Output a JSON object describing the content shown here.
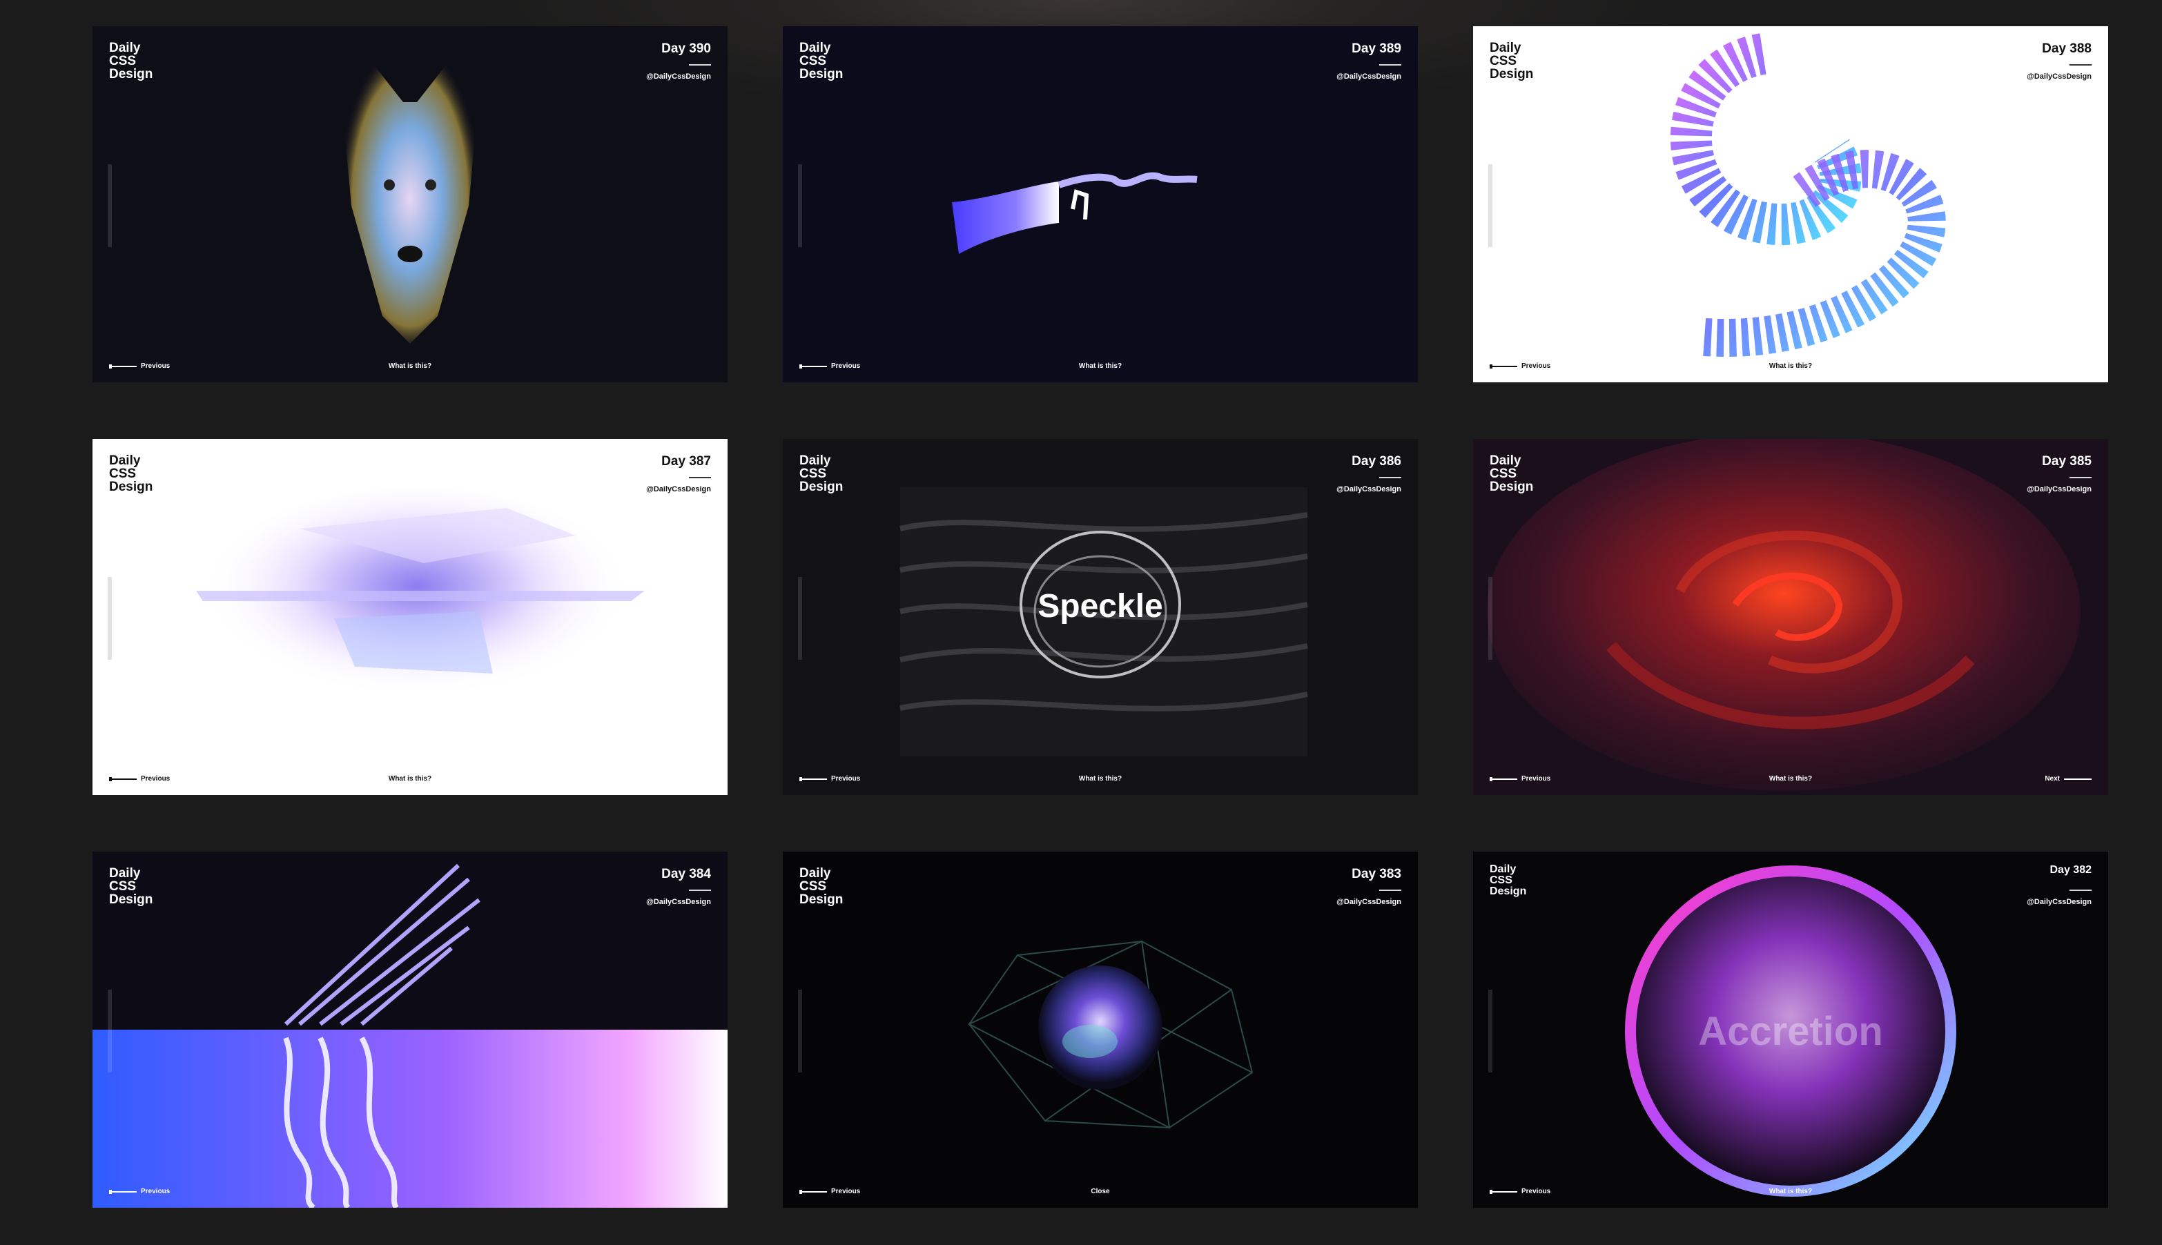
{
  "cards": [
    {
      "logo": [
        "Daily",
        "CSS",
        "Design"
      ],
      "day": "Day 390",
      "handle": "@DailyCssDesign",
      "prev": "Previous",
      "center": "What is this?"
    },
    {
      "logo": [
        "Daily",
        "CSS",
        "Design"
      ],
      "day": "Day 389",
      "handle": "@DailyCssDesign",
      "prev": "Previous",
      "center": "What is this?"
    },
    {
      "logo": [
        "Daily",
        "CSS",
        "Design"
      ],
      "day": "Day 388",
      "handle": "@DailyCssDesign",
      "prev": "Previous",
      "center": "What is this?"
    },
    {
      "logo": [
        "Daily",
        "CSS",
        "Design"
      ],
      "day": "Day 387",
      "handle": "@DailyCssDesign",
      "prev": "Previous",
      "center": "What is this?"
    },
    {
      "logo": [
        "Daily",
        "CSS",
        "Design"
      ],
      "day": "Day 386",
      "handle": "@DailyCssDesign",
      "prev": "Previous",
      "center": "What is this?",
      "artwork_text": "Speckle"
    },
    {
      "logo": [
        "Daily",
        "CSS",
        "Design"
      ],
      "day": "Day 385",
      "handle": "@DailyCssDesign",
      "prev": "Previous",
      "center": "What is this?",
      "next": "Next"
    },
    {
      "logo": [
        "Daily",
        "CSS",
        "Design"
      ],
      "day": "Day 384",
      "handle": "@DailyCssDesign",
      "prev": "Previous"
    },
    {
      "logo": [
        "Daily",
        "CSS",
        "Design"
      ],
      "day": "Day 383",
      "handle": "@DailyCssDesign",
      "prev": "Previous",
      "center": "Close"
    },
    {
      "logo": [
        "Daily",
        "CSS",
        "Design"
      ],
      "day": "Day 382",
      "handle": "@DailyCssDesign",
      "prev": "Previous",
      "center": "What is this?",
      "artwork_text": "Accretion"
    }
  ],
  "colors": {
    "page_bg": "#1b1b1b",
    "card_dark": "#0e0e17",
    "card_light": "#ffffff"
  }
}
